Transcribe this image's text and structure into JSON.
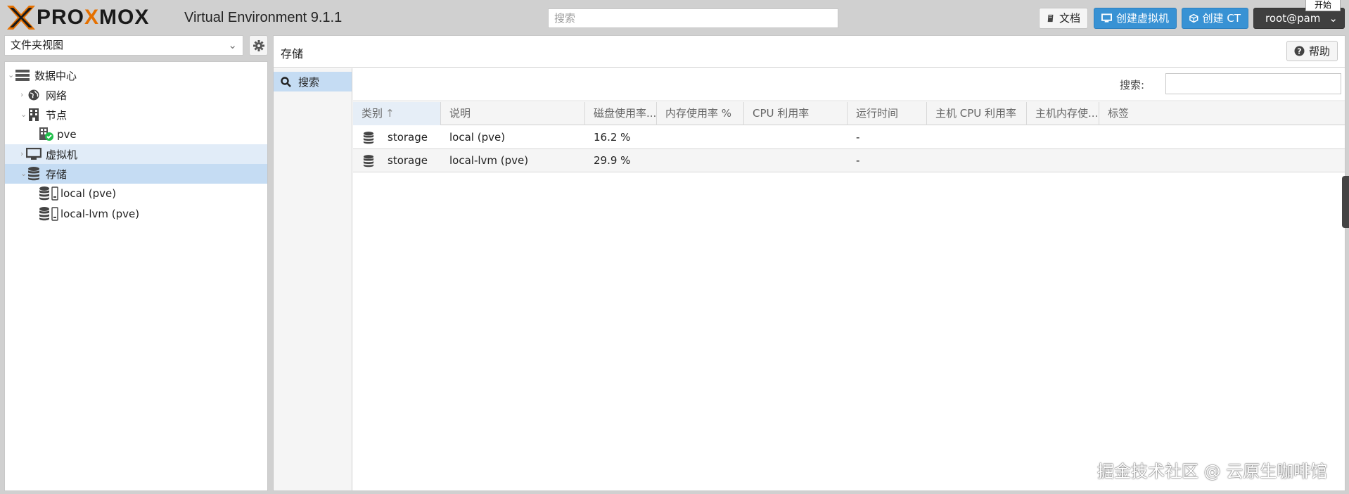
{
  "header": {
    "logo_left": "PRO",
    "logo_mid": "X",
    "logo_right": "MOX",
    "app_title": "Virtual Environment 9.1.1",
    "search_placeholder": "搜索",
    "docs_label": "文档",
    "create_vm_label": "创建虚拟机",
    "create_ct_label": "创建 CT",
    "user_label": "root@pam",
    "start_tip": "开始",
    "accent_color": "#e57000",
    "button_blue": "#3892d4"
  },
  "left": {
    "view_select": "文件夹视图",
    "tree": [
      {
        "label": "数据中心",
        "icon": "server-rack-icon"
      },
      {
        "label": "网络",
        "icon": "globe-icon"
      },
      {
        "label": "节点",
        "icon": "building-icon"
      },
      {
        "label": "pve",
        "icon": "node-ok-icon"
      },
      {
        "label": "虚拟机",
        "icon": "monitor-icon"
      },
      {
        "label": "存储",
        "icon": "database-icon"
      },
      {
        "label": "local (pve)",
        "icon": "storage-icon"
      },
      {
        "label": "local-lvm (pve)",
        "icon": "storage-icon"
      }
    ]
  },
  "main": {
    "title": "存储",
    "help_label": "帮助",
    "side_nav": [
      {
        "label": "搜索",
        "icon": "search-icon"
      }
    ],
    "search_label": "搜索:",
    "columns": [
      "类别",
      "说明",
      "磁盘使用率...",
      "内存使用率 %",
      "CPU 利用率",
      "运行时间",
      "主机 CPU 利用率",
      "主机内存使...",
      "标签"
    ],
    "rows": [
      {
        "type": "storage",
        "description": "local (pve)",
        "disk": "16.2 %",
        "mem": "",
        "cpu": "",
        "uptime": "-",
        "host_cpu": "",
        "host_mem": "",
        "tags": ""
      },
      {
        "type": "storage",
        "description": "local-lvm (pve)",
        "disk": "29.9 %",
        "mem": "",
        "cpu": "",
        "uptime": "-",
        "host_cpu": "",
        "host_mem": "",
        "tags": ""
      }
    ]
  },
  "watermark": "掘金技术社区 @ 云原生咖啡馆"
}
